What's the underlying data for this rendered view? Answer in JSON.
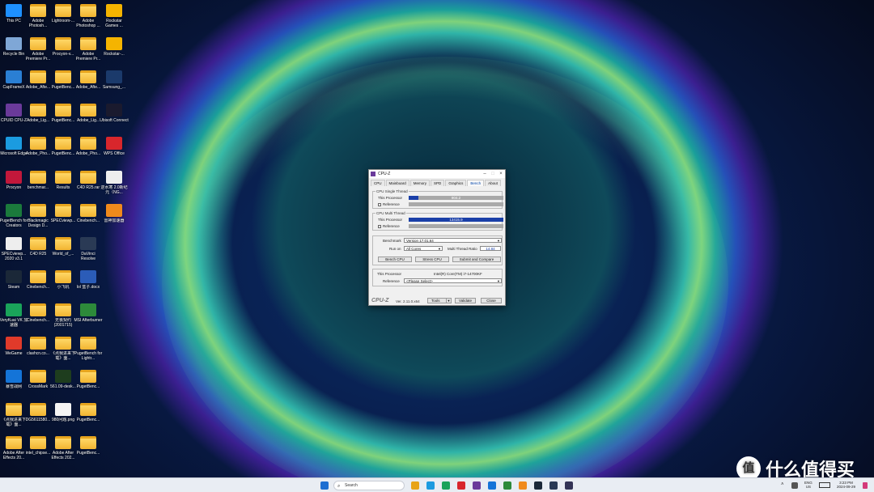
{
  "desktop": {
    "icons": [
      {
        "label": "This PC",
        "col": 0,
        "row": 0,
        "kind": "app",
        "color": "#1e90ff"
      },
      {
        "label": "Adobe Photosh...",
        "col": 1,
        "row": 0,
        "kind": "folder"
      },
      {
        "label": "Lightroom-...",
        "col": 2,
        "row": 0,
        "kind": "folder"
      },
      {
        "label": "Adobe Photoshop ...",
        "col": 3,
        "row": 0,
        "kind": "folder"
      },
      {
        "label": "Rockstar Games ...",
        "col": 4,
        "row": 0,
        "kind": "app",
        "color": "#f5b400"
      },
      {
        "label": "Recycle Bin",
        "col": 0,
        "row": 1,
        "kind": "app",
        "color": "#7fa7d6"
      },
      {
        "label": "Adobe Premiere Pr...",
        "col": 1,
        "row": 1,
        "kind": "folder"
      },
      {
        "label": "Procyon-v...",
        "col": 2,
        "row": 1,
        "kind": "folder"
      },
      {
        "label": "Adobe Premiere Pr...",
        "col": 3,
        "row": 1,
        "kind": "folder"
      },
      {
        "label": "Rockstar-...",
        "col": 4,
        "row": 1,
        "kind": "app",
        "color": "#f5b400"
      },
      {
        "label": "CapFrameX",
        "col": 0,
        "row": 2,
        "kind": "app",
        "color": "#2a7fd4"
      },
      {
        "label": "Adobe_Afte...",
        "col": 1,
        "row": 2,
        "kind": "folder"
      },
      {
        "label": "PugetBenc...",
        "col": 2,
        "row": 2,
        "kind": "folder"
      },
      {
        "label": "Adobe_Afte...",
        "col": 3,
        "row": 2,
        "kind": "folder"
      },
      {
        "label": "Samsung_...",
        "col": 4,
        "row": 2,
        "kind": "app",
        "color": "#1b3a6b"
      },
      {
        "label": "CPUID CPU-Z",
        "col": 0,
        "row": 3,
        "kind": "app",
        "color": "#6a3a9a"
      },
      {
        "label": "Adobe_Lig...",
        "col": 1,
        "row": 3,
        "kind": "folder"
      },
      {
        "label": "PugetBenc...",
        "col": 2,
        "row": 3,
        "kind": "folder"
      },
      {
        "label": "Adobe_Lig...",
        "col": 3,
        "row": 3,
        "kind": "folder"
      },
      {
        "label": "Ubisoft Connect",
        "col": 4,
        "row": 3,
        "kind": "app",
        "color": "#1a1a2e"
      },
      {
        "label": "Microsoft Edge",
        "col": 0,
        "row": 4,
        "kind": "app",
        "color": "#1b9be0"
      },
      {
        "label": "Adobe_Pho...",
        "col": 1,
        "row": 4,
        "kind": "folder"
      },
      {
        "label": "PugetBenc...",
        "col": 2,
        "row": 4,
        "kind": "folder"
      },
      {
        "label": "Adobe_Pho...",
        "col": 3,
        "row": 4,
        "kind": "folder"
      },
      {
        "label": "WPS Office",
        "col": 4,
        "row": 4,
        "kind": "app",
        "color": "#d8262c"
      },
      {
        "label": "Procyon",
        "col": 0,
        "row": 5,
        "kind": "app",
        "color": "#c2183b"
      },
      {
        "label": "benchmar...",
        "col": 1,
        "row": 5,
        "kind": "folder"
      },
      {
        "label": "Results",
        "col": 2,
        "row": 5,
        "kind": "folder"
      },
      {
        "label": "C4D R25.rar",
        "col": 3,
        "row": 5,
        "kind": "folder"
      },
      {
        "label": "逆水寒 2.0新纪元（NG...",
        "col": 4,
        "row": 5,
        "kind": "app",
        "color": "#eeeeee"
      },
      {
        "label": "PugetBench for Creators",
        "col": 0,
        "row": 6,
        "kind": "app",
        "color": "#1b7a3c"
      },
      {
        "label": "Blackmagic Design D...",
        "col": 1,
        "row": 6,
        "kind": "folder"
      },
      {
        "label": "SPECviewp...",
        "col": 2,
        "row": 6,
        "kind": "folder"
      },
      {
        "label": "Cinebench...",
        "col": 3,
        "row": 6,
        "kind": "folder"
      },
      {
        "label": "雷神加速器",
        "col": 4,
        "row": 6,
        "kind": "app",
        "color": "#f08a1c"
      },
      {
        "label": "SPECviewp... 2020 v3.1",
        "col": 0,
        "row": 7,
        "kind": "app",
        "color": "#eeeeee"
      },
      {
        "label": "C4D R25",
        "col": 1,
        "row": 7,
        "kind": "folder"
      },
      {
        "label": "World_of_...",
        "col": 2,
        "row": 7,
        "kind": "folder"
      },
      {
        "label": "DaVinci Resolve",
        "col": 3,
        "row": 7,
        "kind": "app",
        "color": "#2a3a55"
      },
      {
        "label": "Steam",
        "col": 0,
        "row": 8,
        "kind": "app",
        "color": "#1b2838"
      },
      {
        "label": "Cinebench...",
        "col": 1,
        "row": 8,
        "kind": "folder"
      },
      {
        "label": "小飞机",
        "col": 2,
        "row": 8,
        "kind": "folder"
      },
      {
        "label": "lol 盒子.docx",
        "col": 3,
        "row": 8,
        "kind": "app",
        "color": "#2b5cb8"
      },
      {
        "label": "VeryKuai VK 加速器",
        "col": 0,
        "row": 9,
        "kind": "app",
        "color": "#1aa35a"
      },
      {
        "label": "Cinebench...",
        "col": 1,
        "row": 9,
        "kind": "folder"
      },
      {
        "label": "无畏契约 (2001715)",
        "col": 2,
        "row": 9,
        "kind": "folder"
      },
      {
        "label": "MSI Afterburner",
        "col": 3,
        "row": 9,
        "kind": "app",
        "color": "#2d8a3a"
      },
      {
        "label": "WeGame",
        "col": 0,
        "row": 10,
        "kind": "app",
        "color": "#e03a2a"
      },
      {
        "label": "clashcn.co...",
        "col": 1,
        "row": 10,
        "kind": "folder"
      },
      {
        "label": "《点我进来下载》面...",
        "col": 2,
        "row": 10,
        "kind": "folder"
      },
      {
        "label": "PugetBench for Lightr...",
        "col": 3,
        "row": 10,
        "kind": "folder"
      },
      {
        "label": "暴雪战网",
        "col": 0,
        "row": 11,
        "kind": "app",
        "color": "#1474d8"
      },
      {
        "label": "CrossMark",
        "col": 1,
        "row": 11,
        "kind": "folder"
      },
      {
        "label": "561.09-desk...",
        "col": 2,
        "row": 11,
        "kind": "app",
        "color": "#1e3d1e"
      },
      {
        "label": "PugetBenc...",
        "col": 3,
        "row": 11,
        "kind": "folder"
      },
      {
        "label": "《点我进来下载》面...",
        "col": 0,
        "row": 12,
        "kind": "folder"
      },
      {
        "label": "DG5611580...",
        "col": 1,
        "row": 12,
        "kind": "folder"
      },
      {
        "label": "980问题.png",
        "col": 2,
        "row": 12,
        "kind": "app",
        "color": "#f4f4f4"
      },
      {
        "label": "PugetBenc...",
        "col": 3,
        "row": 12,
        "kind": "folder"
      },
      {
        "label": "Adobe After Effects 20...",
        "col": 0,
        "row": 13,
        "kind": "folder"
      },
      {
        "label": "intel_chipse...",
        "col": 1,
        "row": 13,
        "kind": "folder"
      },
      {
        "label": "Adobe After Effects 202...",
        "col": 2,
        "row": 13,
        "kind": "folder"
      },
      {
        "label": "PugetBenc...",
        "col": 3,
        "row": 13,
        "kind": "folder"
      }
    ]
  },
  "cpuz": {
    "title": "CPU-Z",
    "tabs": [
      "CPU",
      "Mainboard",
      "Memory",
      "SPD",
      "Graphics",
      "Bench",
      "About"
    ],
    "active_tab": "Bench",
    "single": {
      "group_title": "CPU Single Thread",
      "this_label": "This Processor",
      "this_value": "904.2",
      "this_fraction": 0.1,
      "ref_label": "Reference"
    },
    "multi": {
      "group_title": "CPU Multi Thread",
      "this_label": "This Processor",
      "this_value": "13415.9",
      "this_fraction": 1.0,
      "ref_label": "Reference"
    },
    "benchmark_label": "Benchmark",
    "benchmark_value": "Version 17.01.64",
    "runon_label": "Run on",
    "runon_value": "All Cores",
    "ratio_label": "Multi Thread Ratio",
    "ratio_value": "14.84",
    "bench_button": "Bench CPU",
    "stress_button": "Stress CPU",
    "submit_button": "Submit and Compare",
    "this_processor_label": "This Processor",
    "this_processor_value": "Intel(R) Core(TM) i7-14700KF",
    "reference_label": "Reference",
    "reference_value": "<Please Select>",
    "footer_logo": "CPU-Z",
    "version": "Ver. 2.11.0.x64",
    "tools_button": "Tools",
    "validate_button": "Validate",
    "close_button": "Close"
  },
  "taskbar": {
    "search_placeholder": "Search",
    "lang_top": "ENG",
    "lang_bottom": "US",
    "time": "3:23 PM",
    "date": "2024-09-29",
    "pinned_colors": [
      "#e8a317",
      "#1b9be0",
      "#1aa35a",
      "#d8262c",
      "#6a3a9a",
      "#1474d8",
      "#2d8a3a",
      "#f08a1c",
      "#1b2838",
      "#2a3a55",
      "#333355"
    ]
  },
  "watermark": {
    "logo_char": "值",
    "text": "什么值得买"
  }
}
